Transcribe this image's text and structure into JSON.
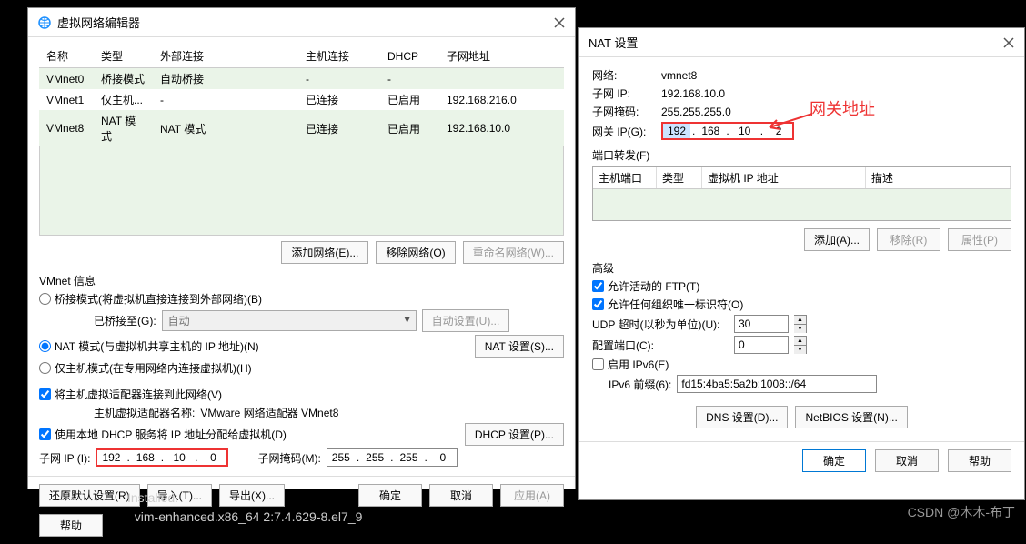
{
  "dialog1": {
    "title": "虚拟网络编辑器",
    "columns": [
      "名称",
      "类型",
      "外部连接",
      "主机连接",
      "DHCP",
      "子网地址"
    ],
    "rows": [
      {
        "name": "VMnet0",
        "type": "桥接模式",
        "ext": "自动桥接",
        "host": "-",
        "dhcp": "-",
        "subnet": ""
      },
      {
        "name": "VMnet1",
        "type": "仅主机...",
        "ext": "-",
        "host": "已连接",
        "dhcp": "已启用",
        "subnet": "192.168.216.0"
      },
      {
        "name": "VMnet8",
        "type": "NAT 模式",
        "ext": "NAT 模式",
        "host": "已连接",
        "dhcp": "已启用",
        "subnet": "192.168.10.0"
      }
    ],
    "add_network": "添加网络(E)...",
    "remove_network": "移除网络(O)",
    "rename_network": "重命名网络(W)...",
    "vmnet_info": "VMnet 信息",
    "bridge_mode": "桥接模式(将虚拟机直接连接到外部网络)(B)",
    "bridged_to": "已桥接至(G):",
    "bridged_select": "自动",
    "auto_setting": "自动设置(U)...",
    "nat_mode": "NAT 模式(与虚拟机共享主机的 IP 地址)(N)",
    "nat_setting": "NAT 设置(S)...",
    "host_only": "仅主机模式(在专用网络内连接虚拟机)(H)",
    "connect_adapter": "将主机虚拟适配器连接到此网络(V)",
    "adapter_name_label": "主机虚拟适配器名称:",
    "adapter_name": "VMware 网络适配器 VMnet8",
    "use_dhcp": "使用本地 DHCP 服务将 IP 地址分配给虚拟机(D)",
    "dhcp_setting": "DHCP 设置(P)...",
    "subnet_ip_label": "子网 IP (I):",
    "subnet_ip": [
      "192",
      "168",
      "10",
      "0"
    ],
    "subnet_mask_label": "子网掩码(M):",
    "subnet_mask": [
      "255",
      "255",
      "255",
      "0"
    ],
    "restore": "还原默认设置(R)",
    "import": "导入(T)...",
    "export": "导出(X)...",
    "ok": "确定",
    "cancel": "取消",
    "apply": "应用(A)",
    "help": "帮助"
  },
  "dialog2": {
    "title": "NAT 设置",
    "network_label": "网络:",
    "network": "vmnet8",
    "subnet_ip_label": "子网 IP:",
    "subnet_ip": "192.168.10.0",
    "subnet_mask_label": "子网掩码:",
    "subnet_mask": "255.255.255.0",
    "gateway_label": "网关 IP(G):",
    "gateway_ip": [
      "192",
      "168",
      "10",
      "2"
    ],
    "port_forward": "端口转发(F)",
    "port_cols": [
      "主机端口",
      "类型",
      "虚拟机 IP 地址",
      "描述"
    ],
    "add": "添加(A)...",
    "remove": "移除(R)",
    "properties": "属性(P)",
    "advanced": "高级",
    "allow_ftp": "允许活动的 FTP(T)",
    "allow_any": "允许任何组织唯一标识符(O)",
    "udp_timeout_label": "UDP 超时(以秒为单位)(U):",
    "udp_timeout": "30",
    "config_port_label": "配置端口(C):",
    "config_port": "0",
    "ipv6_enable": "启用 IPv6(E)",
    "ipv6_prefix_label": "IPv6 前缀(6):",
    "ipv6_prefix": "fd15:4ba5:5a2b:1008::/64",
    "dns_setting": "DNS 设置(D)...",
    "netbios_setting": "NetBIOS 设置(N)...",
    "ok": "确定",
    "cancel": "取消",
    "help": "帮助"
  },
  "annotation": "网关地址",
  "terminal": {
    "line1": "Installed:",
    "line2": "  vim-enhanced.x86_64 2:7.4.629-8.el7_9"
  },
  "watermark": "CSDN @木木-布丁"
}
